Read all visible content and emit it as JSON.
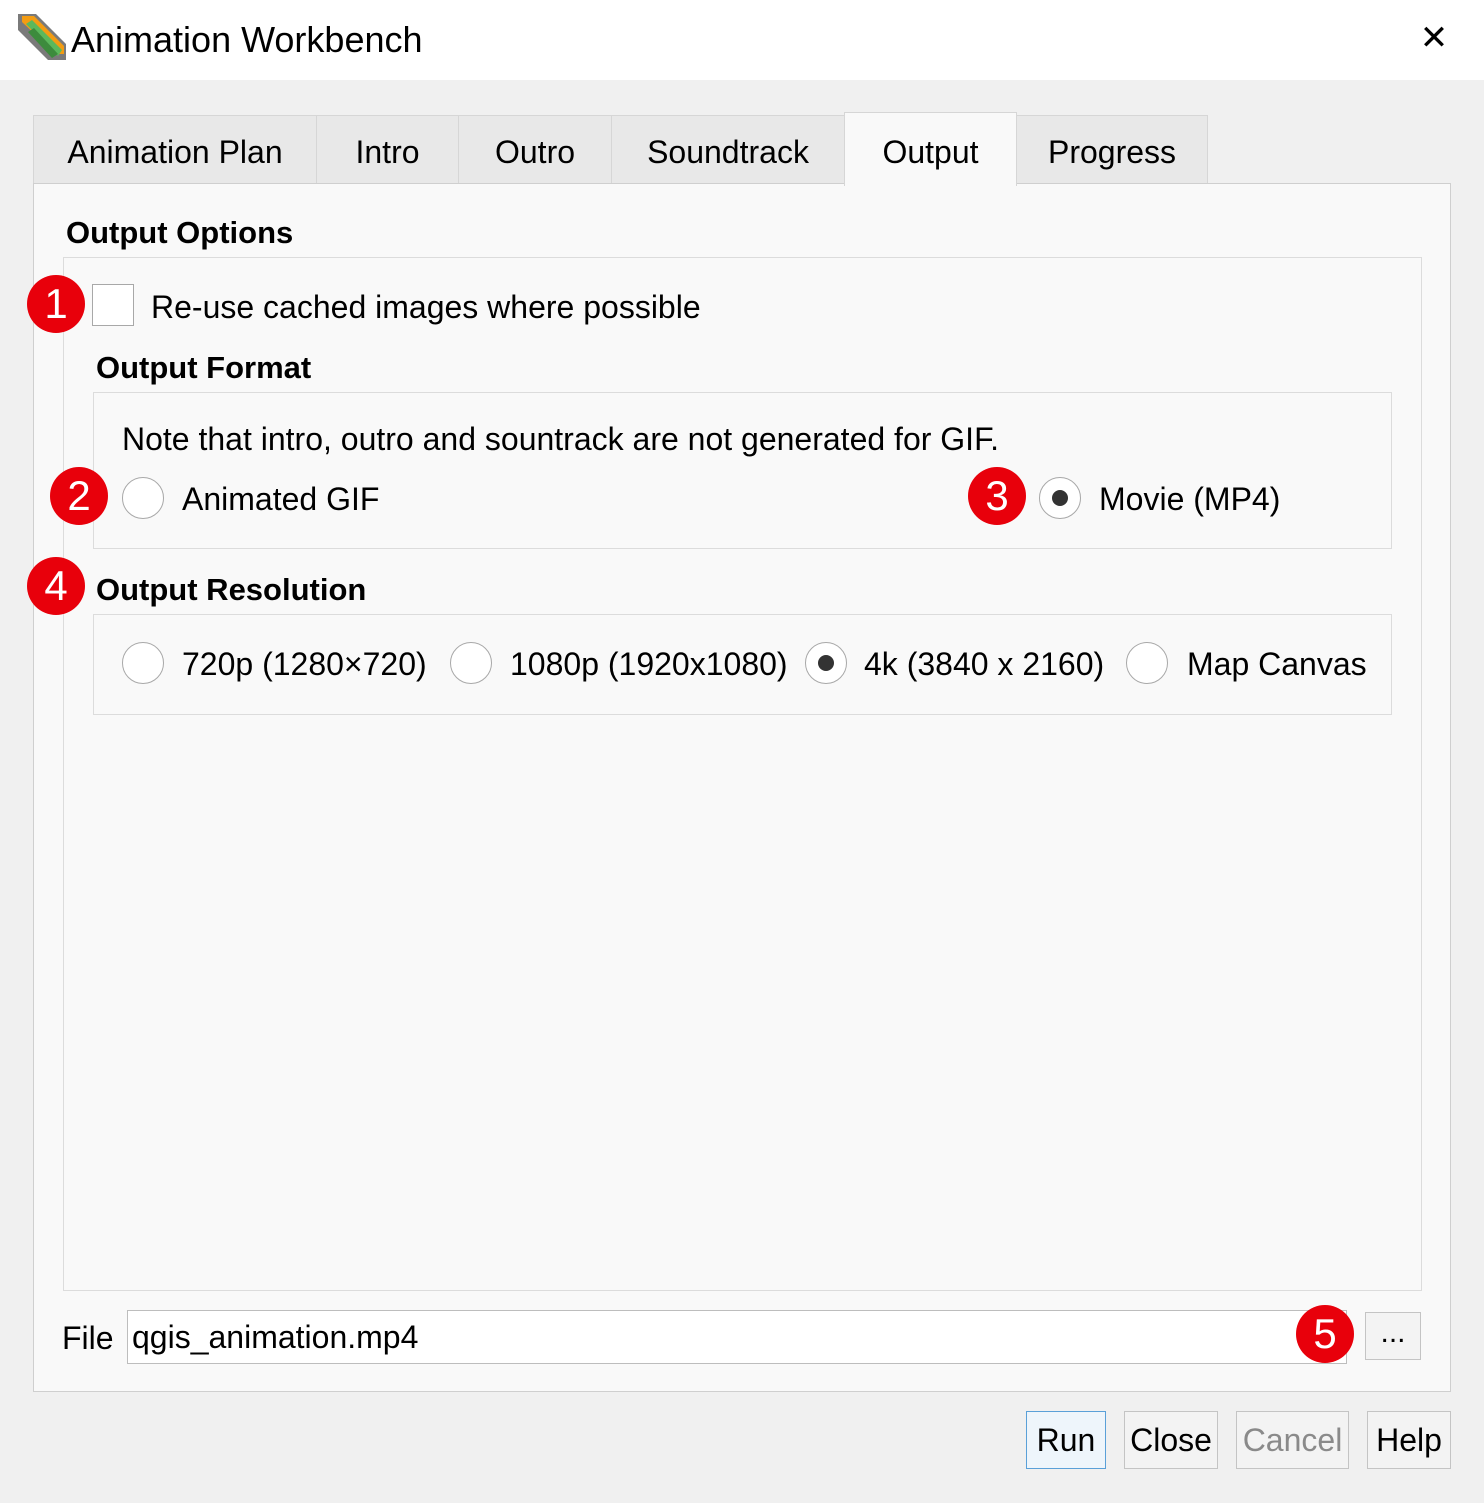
{
  "window": {
    "title": "Animation Workbench",
    "close_symbol": "✕"
  },
  "tabs": [
    {
      "label": "Animation Plan",
      "active": false
    },
    {
      "label": "Intro",
      "active": false
    },
    {
      "label": "Outro",
      "active": false
    },
    {
      "label": "Soundtrack",
      "active": false
    },
    {
      "label": "Output",
      "active": true
    },
    {
      "label": "Progress",
      "active": false
    }
  ],
  "output_options": {
    "heading": "Output Options",
    "reuse_cache": {
      "label": "Re-use cached images where possible",
      "checked": false
    }
  },
  "output_format": {
    "heading": "Output Format",
    "note": "Note that intro, outro and sountrack are not generated for GIF.",
    "options": [
      {
        "label": "Animated GIF",
        "checked": false
      },
      {
        "label": "Movie (MP4)",
        "checked": true
      }
    ]
  },
  "output_resolution": {
    "heading": "Output Resolution",
    "options": [
      {
        "label": "720p (1280×720)",
        "checked": false
      },
      {
        "label": "1080p (1920x1080)",
        "checked": false
      },
      {
        "label": "4k (3840 x 2160)",
        "checked": true
      },
      {
        "label": "Map Canvas",
        "checked": false
      }
    ]
  },
  "file": {
    "label": "File",
    "value": "qgis_animation.mp4",
    "browse_label": "..."
  },
  "buttons": {
    "run": "Run",
    "close": "Close",
    "cancel": "Cancel",
    "help": "Help"
  },
  "badges": [
    "1",
    "2",
    "3",
    "4",
    "5"
  ],
  "colors": {
    "badge": "#e8000b",
    "default_button_border": "#5aa0d8"
  },
  "icons": {
    "app": "qgis-animation-workbench-icon",
    "close": "close-icon"
  }
}
